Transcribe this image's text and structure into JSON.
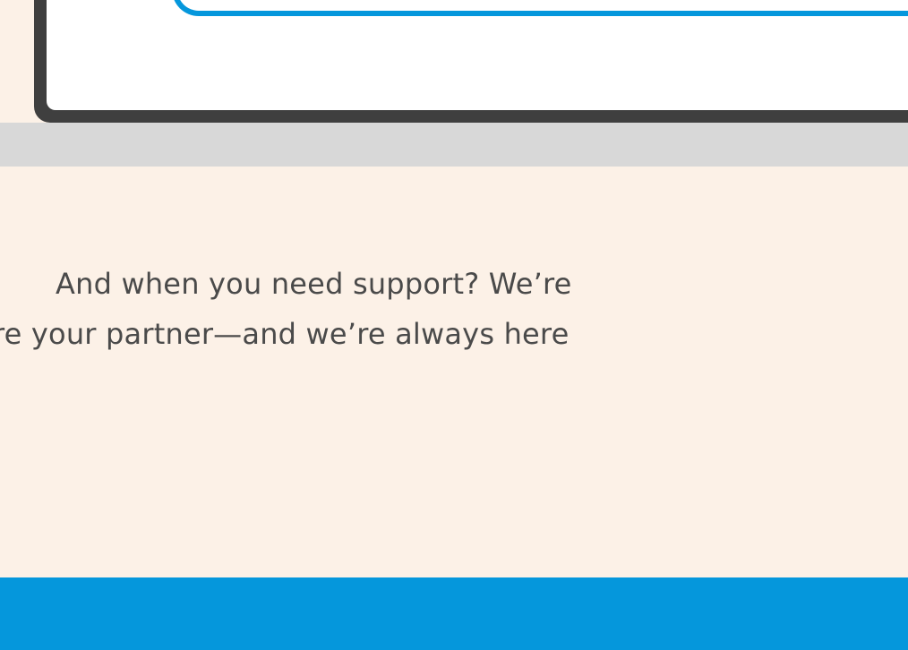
{
  "colors": {
    "background": "#fcf1e7",
    "frame": "#3f3f3f",
    "screen": "#ffffff",
    "accent": "#0597dc",
    "divider": "#d8d8d8",
    "text": "#4a4a4a"
  },
  "support_section": {
    "line1": "And when you need support? We’re",
    "line2": "re your partner—and we’re always here"
  }
}
